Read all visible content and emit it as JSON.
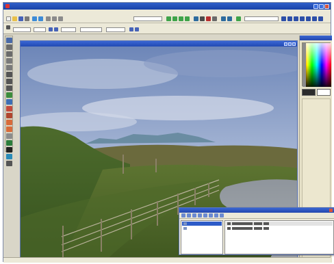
{
  "app": {
    "title": "",
    "menu": [
      "",
      "",
      "",
      "",
      "",
      "",
      "",
      "",
      "",
      "",
      "",
      ""
    ]
  },
  "document": {
    "title": ""
  },
  "palettes": {
    "color_title": "",
    "layers_title": ""
  },
  "layers": [
    {
      "name": "",
      "selected": true
    },
    {
      "name": "",
      "selected": false
    }
  ],
  "status": {
    "left": "",
    "right": ""
  },
  "colors": {
    "titlebar": "#1f4bb5",
    "chrome": "#ece9d8",
    "foreground_color": "#2b2b2b",
    "background_color": "#ffffff"
  },
  "icons": [
    "app-icon",
    "new-icon",
    "open-icon",
    "save-icon",
    "print-icon",
    "undo-icon",
    "redo-icon",
    "zoom-icon",
    "brush-icon",
    "eraser-icon",
    "text-icon",
    "fill-icon",
    "selection-icon",
    "eyedropper-icon",
    "move-icon",
    "close-icon",
    "minimize-icon",
    "maximize-icon"
  ]
}
